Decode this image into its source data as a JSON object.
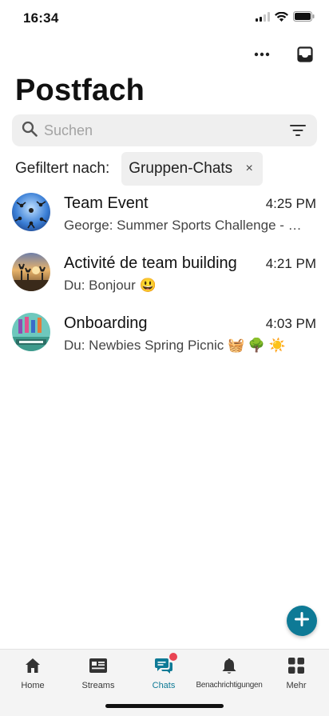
{
  "status_bar": {
    "time": "16:34"
  },
  "header": {
    "title": "Postfach"
  },
  "search": {
    "placeholder": "Suchen"
  },
  "filter": {
    "label": "Gefiltert nach:",
    "chip": "Gruppen-Chats",
    "close_symbol": "×"
  },
  "chats": [
    {
      "name": "Team Event",
      "time": "4:25 PM",
      "preview": "George: Summer Sports Challenge - Get ready for the ultimate summer showdown!"
    },
    {
      "name": "Activité de team building",
      "time": "4:21 PM",
      "preview": "Du: Bonjour 😃"
    },
    {
      "name": "Onboarding",
      "time": "4:03 PM",
      "preview": "Du: Newbies Spring Picnic 🧺 🌳 ☀️"
    }
  ],
  "tabs": [
    {
      "label": "Home",
      "icon": "home-icon"
    },
    {
      "label": "Streams",
      "icon": "streams-icon"
    },
    {
      "label": "Chats",
      "icon": "chats-icon",
      "active": true
    },
    {
      "label": "Benachrichtigungen",
      "icon": "bell-icon"
    },
    {
      "label": "Mehr",
      "icon": "grid-icon"
    }
  ],
  "colors": {
    "accent": "#0e7a96",
    "badge": "#e94452",
    "search_bg": "#efefef"
  }
}
